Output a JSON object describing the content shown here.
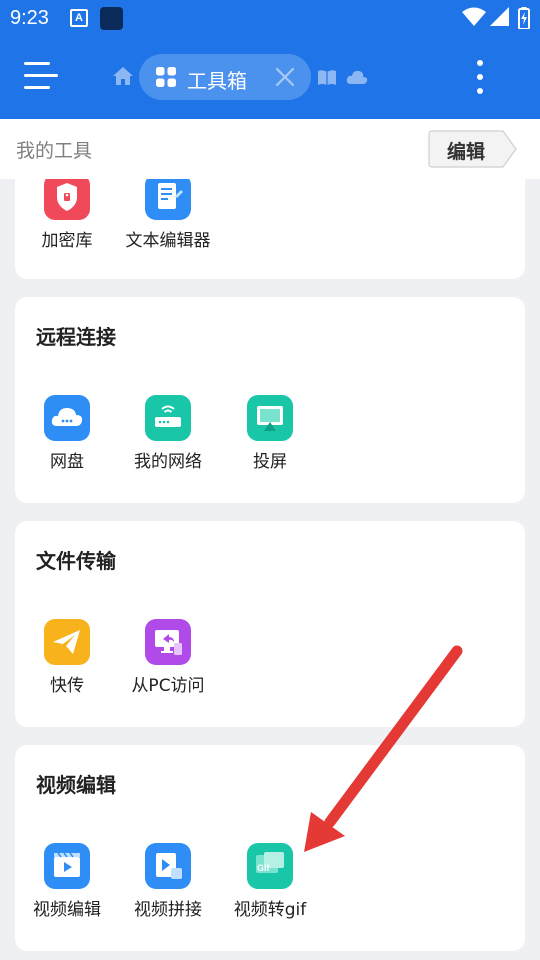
{
  "status_bar": {
    "time": "9:23",
    "notification_letter": "A"
  },
  "header": {
    "active_tab": {
      "label": "工具箱",
      "icon": "grid-icon"
    },
    "icons": [
      "menu-icon",
      "home-icon",
      "close-icon",
      "book-icon",
      "cloud-icon",
      "more-vert-icon"
    ]
  },
  "subheader": {
    "title": "我的工具",
    "edit_label": "编辑"
  },
  "sections": [
    {
      "title": "",
      "tools": [
        {
          "label": "加密库",
          "icon": "shield-lock-icon",
          "color": "#f04a5a"
        },
        {
          "label": "文本编辑器",
          "icon": "text-editor-icon",
          "color": "#2e8ef5"
        }
      ]
    },
    {
      "title": "远程连接",
      "tools": [
        {
          "label": "网盘",
          "icon": "cloud-drive-icon",
          "color": "#2e8ef5"
        },
        {
          "label": "我的网络",
          "icon": "router-icon",
          "color": "#19c6a8"
        },
        {
          "label": "投屏",
          "icon": "screen-cast-icon",
          "color": "#19c6a8"
        }
      ]
    },
    {
      "title": "文件传输",
      "tools": [
        {
          "label": "快传",
          "icon": "paper-plane-icon",
          "color": "#f7b21c"
        },
        {
          "label": "从PC访问",
          "icon": "pc-access-icon",
          "color": "#b04ae8"
        }
      ]
    },
    {
      "title": "视频编辑",
      "tools": [
        {
          "label": "视频编辑",
          "icon": "video-edit-icon",
          "color": "#2e8ef5"
        },
        {
          "label": "视频拼接",
          "icon": "video-join-icon",
          "color": "#2e8ef5"
        },
        {
          "label": "视频转gif",
          "icon": "video-to-gif-icon",
          "color": "#19c6a8",
          "badge": "Gif"
        }
      ]
    }
  ],
  "annotation": {
    "icon": "red-arrow-icon",
    "color": "#e53935"
  }
}
